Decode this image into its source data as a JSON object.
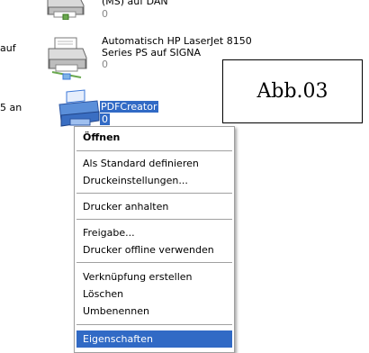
{
  "left_fragments": [
    "auf",
    "5 an"
  ],
  "printers": [
    {
      "name_line1": "(MS) auf DAN",
      "count": "0"
    },
    {
      "name_line1": "Automatisch HP LaserJet 8150",
      "name_line2": "Series PS auf SIGNA",
      "count": "0"
    },
    {
      "name_line1": "PDFCreator",
      "count": "0",
      "selected": true
    }
  ],
  "caption": "Abb.03",
  "context_menu": {
    "items": [
      {
        "label": "Öffnen",
        "bold": true
      },
      {
        "label": "Als Standard definieren"
      },
      {
        "label": "Druckeinstellungen..."
      },
      {
        "label": "Drucker anhalten"
      },
      {
        "label": "Freigabe..."
      },
      {
        "label": "Drucker offline verwenden"
      },
      {
        "label": "Verknüpfung erstellen"
      },
      {
        "label": "Löschen"
      },
      {
        "label": "Umbenennen"
      },
      {
        "label": "Eigenschaften",
        "highlighted": true
      }
    ]
  },
  "colors": {
    "selection": "#316ac5",
    "menu_border": "#a0a0a0"
  }
}
